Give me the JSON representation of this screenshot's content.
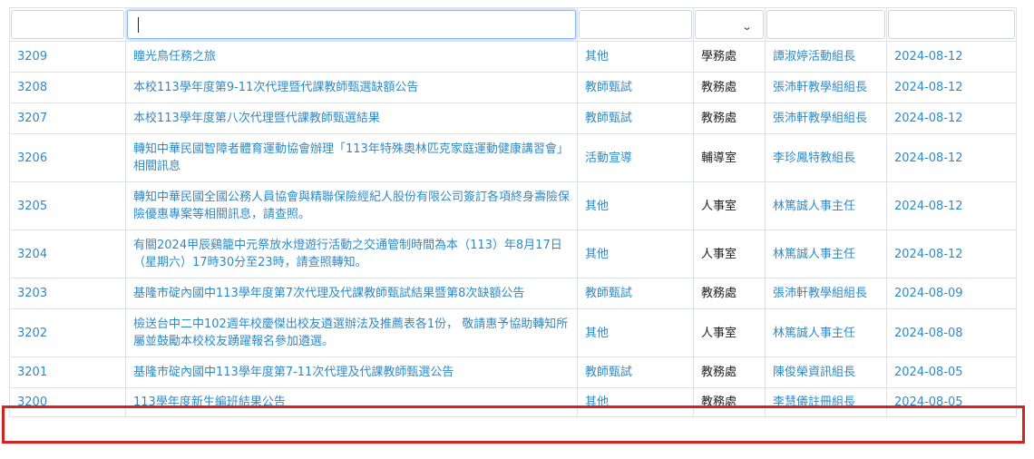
{
  "filters": {
    "title_value": "",
    "select_value": ""
  },
  "rows": [
    {
      "id": "3209",
      "title": "瞳光鳥任務之旅",
      "category": "其他",
      "office": "學務處",
      "author": "譚淑婷活動組長",
      "date": "2024-08-12"
    },
    {
      "id": "3208",
      "title": "本校113學年度第9-11次代理暨代課教師甄選缺額公告",
      "category": "教師甄試",
      "office": "教務處",
      "author": "張沛軒教學組組長",
      "date": "2024-08-12"
    },
    {
      "id": "3207",
      "title": "本校113學年度第八次代理暨代課教師甄選結果",
      "category": "教師甄試",
      "office": "教務處",
      "author": "張沛軒教學組組長",
      "date": "2024-08-12"
    },
    {
      "id": "3206",
      "title": "轉知中華民國智障者體育運動協會辦理「113年特殊奧林匹克家庭運動健康講習會」相關訊息",
      "category": "活動宣導",
      "office": "輔導室",
      "author": "李珍鳳特教組長",
      "date": "2024-08-12"
    },
    {
      "id": "3205",
      "title": "轉知中華民國全國公務人員協會與精聯保險經紀人股份有限公司簽訂各項終身壽險保險優惠專案等相關訊息，請查照。",
      "category": "其他",
      "office": "人事室",
      "author": "林篤誠人事主任",
      "date": "2024-08-12"
    },
    {
      "id": "3204",
      "title": "有關2024甲辰鷄籠中元祭放水燈遊行活動之交通管制時間為本（113）年8月17日（星期六）17時30分至23時，請查照轉知。",
      "category": "其他",
      "office": "人事室",
      "author": "林篤誠人事主任",
      "date": "2024-08-12"
    },
    {
      "id": "3203",
      "title": "基隆市碇內國中113學年度第7次代理及代課教師甄試結果暨第8次缺額公告",
      "category": "教師甄試",
      "office": "教務處",
      "author": "張沛軒教學組組長",
      "date": "2024-08-09"
    },
    {
      "id": "3202",
      "title": "檢送台中二中102週年校慶傑出校友遴選辦法及推薦表各1份， 敬請惠予協助轉知所屬並鼓勵本校校友踴躍報名參加遴選。",
      "category": "其他",
      "office": "人事室",
      "author": "林篤誠人事主任",
      "date": "2024-08-08"
    },
    {
      "id": "3201",
      "title": "基隆市碇內國中113學年度第7-11次代理及代課教師甄選公告",
      "category": "教師甄試",
      "office": "教務處",
      "author": "陳俊榮資訊組長",
      "date": "2024-08-05"
    },
    {
      "id": "3200",
      "title": "113學年度新生編班結果公告",
      "category": "其他",
      "office": "教務處",
      "author": "李慧儀註冊組長",
      "date": "2024-08-05"
    }
  ],
  "icons": {
    "select_caret": "chevron-down-icon"
  },
  "colors": {
    "link": "#2e8ac7",
    "highlight": "#d6231f",
    "border": "#dee2e6"
  }
}
